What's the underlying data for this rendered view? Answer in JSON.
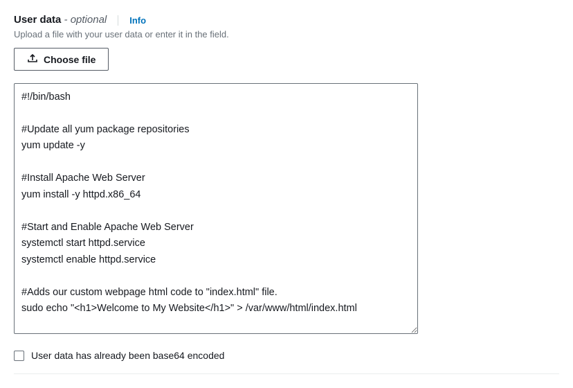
{
  "header": {
    "title": "User data",
    "optional_label": " - optional",
    "info_link": "Info"
  },
  "subtitle": "Upload a file with your user data or enter it in the field.",
  "choose_file_button": "Choose file",
  "userdata_script": "#!/bin/bash\n\n#Update all yum package repositories\nyum update -y\n\n#Install Apache Web Server\nyum install -y httpd.x86_64\n\n#Start and Enable Apache Web Server\nsystemctl start httpd.service\nsystemctl enable httpd.service\n\n#Adds our custom webpage html code to \"index.html\" file.\nsudo echo \"<h1>Welcome to My Website</h1>\" > /var/www/html/index.html",
  "checkbox": {
    "label": "User data has already been base64 encoded",
    "checked": false
  }
}
